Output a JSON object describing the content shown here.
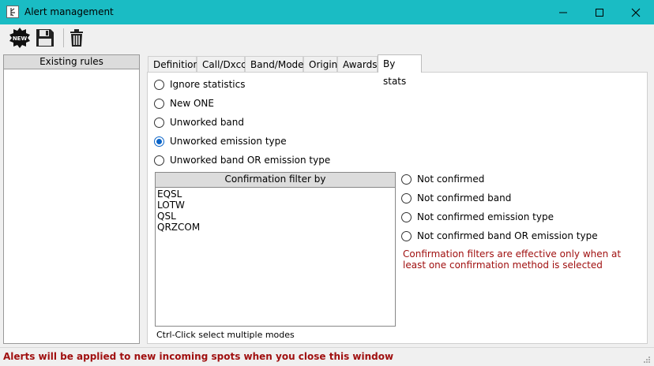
{
  "window": {
    "title": "Alert management"
  },
  "toolbar": {
    "new_label": "NEW"
  },
  "rules": {
    "header": "Existing rules"
  },
  "tabs": [
    {
      "label": "Definition"
    },
    {
      "label": "Call/Dxcc"
    },
    {
      "label": "Band/Mode"
    },
    {
      "label": "Origin"
    },
    {
      "label": "Awards"
    },
    {
      "label": "By stats"
    }
  ],
  "active_tab": "By stats",
  "stats_options": [
    {
      "label": "Ignore statistics",
      "selected": false
    },
    {
      "label": "New ONE",
      "selected": false
    },
    {
      "label": "Unworked band",
      "selected": false
    },
    {
      "label": "Unworked emission type",
      "selected": true
    },
    {
      "label": "Unworked band OR emission type",
      "selected": false
    }
  ],
  "confirmation": {
    "header": "Confirmation filter by",
    "items": [
      "EQSL",
      "LOTW",
      "QSL",
      "QRZCOM"
    ],
    "hint": "Ctrl-Click select multiple modes",
    "options": [
      {
        "label": "Not confirmed",
        "selected": false
      },
      {
        "label": "Not confirmed band",
        "selected": false
      },
      {
        "label": "Not confirmed emission type",
        "selected": false
      },
      {
        "label": "Not confirmed band OR emission type",
        "selected": false
      }
    ],
    "note": "Confirmation filters are effective only when at least one confirmation method is selected"
  },
  "status": {
    "text": "Alerts will be applied to new incoming spots when you close this window"
  },
  "colors": {
    "titlebar": "#1abcc4",
    "selected_radio": "#0a64c8",
    "warning_text": "#a01010"
  }
}
